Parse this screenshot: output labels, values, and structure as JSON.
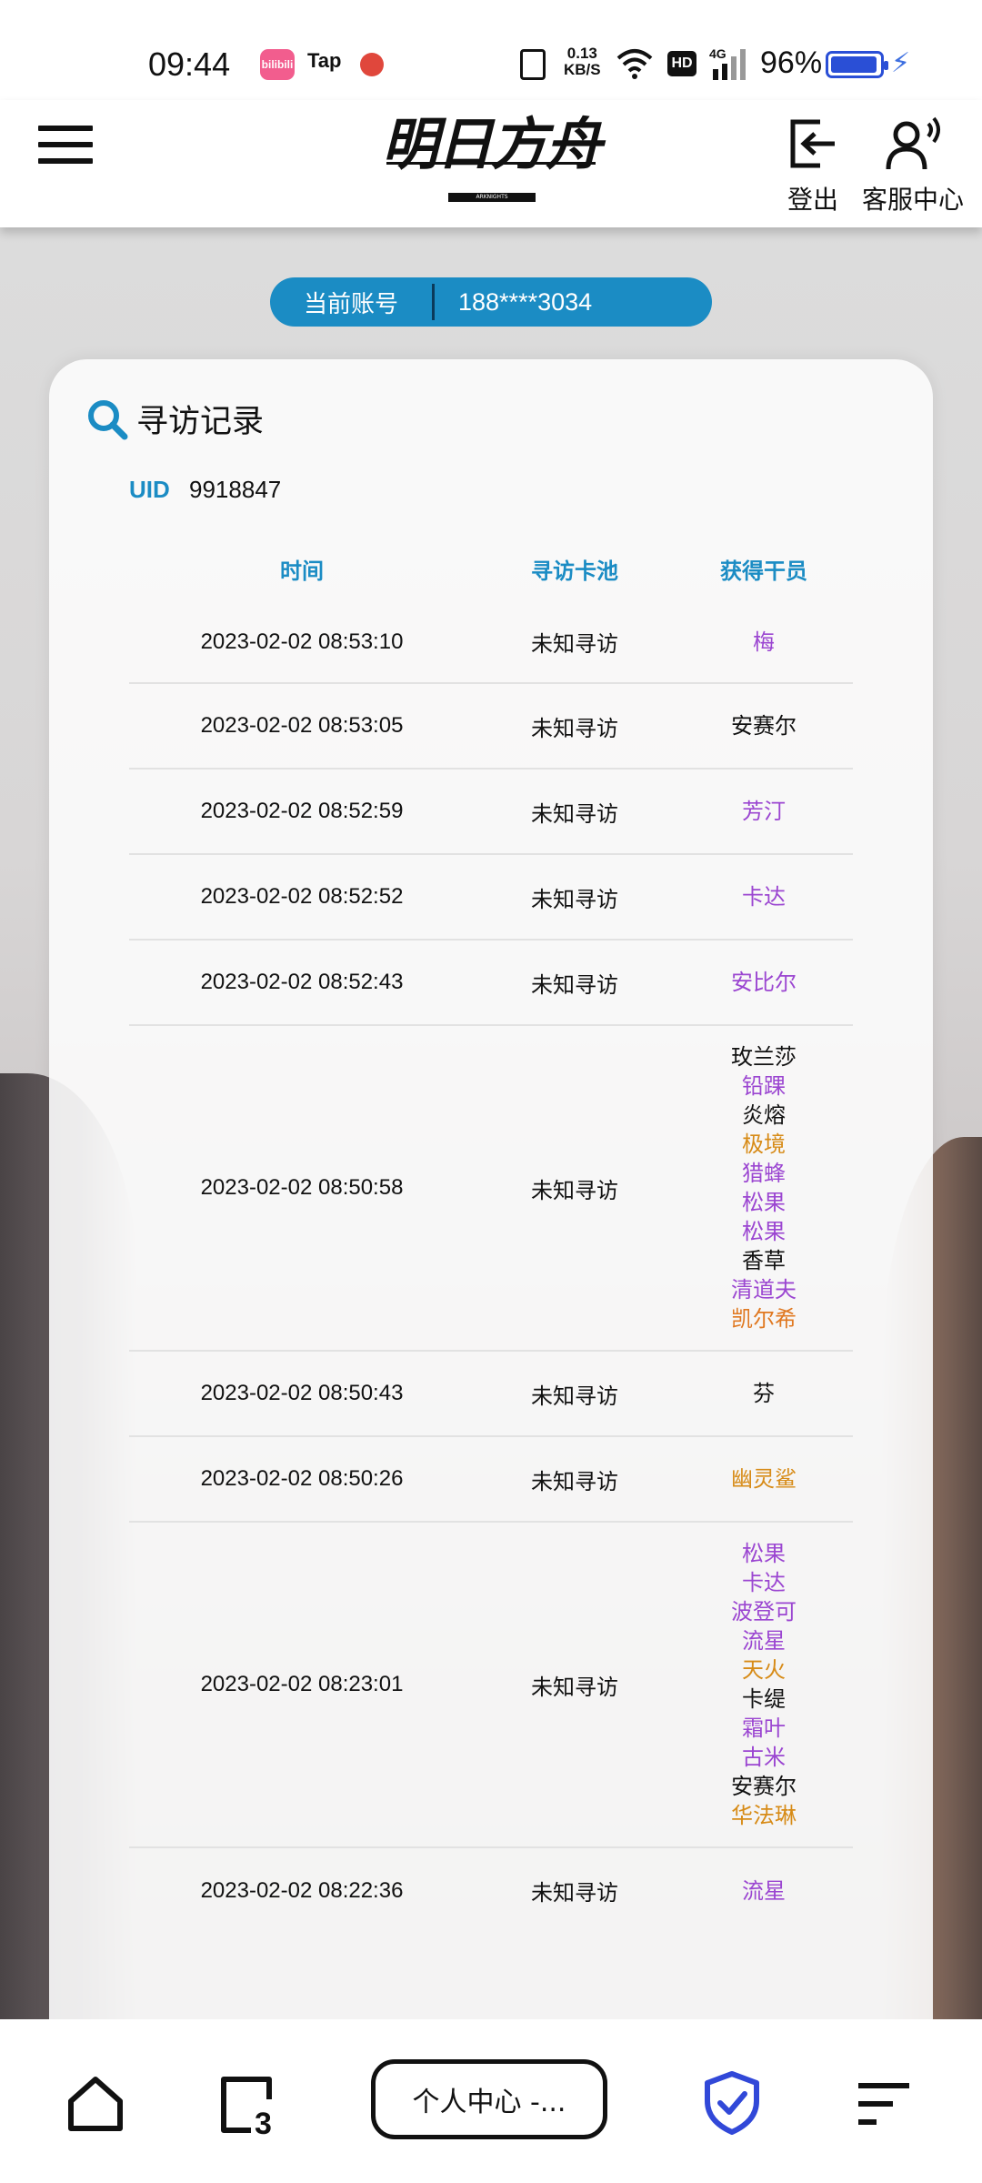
{
  "status_bar": {
    "time": "09:44",
    "apps": [
      "bilibili",
      "Tap"
    ],
    "net_speed_value": "0.13",
    "net_speed_unit": "KB/S",
    "hd": "HD",
    "network": "4G",
    "battery": "96%",
    "battery_level": 0.96
  },
  "header": {
    "logo_text": "明日方舟",
    "logo_sub": "ARKNIGHTS",
    "logout_label": "登出",
    "service_label": "客服中心"
  },
  "account": {
    "label": "当前账号",
    "value": "188****3034"
  },
  "card": {
    "title": "寻访记录",
    "uid_label": "UID",
    "uid_value": "9918847",
    "columns": {
      "time": "时间",
      "pool": "寻访卡池",
      "operator": "获得干员"
    }
  },
  "records": [
    {
      "time": "2023-02-02 08:53:10",
      "pool": "未知寻访",
      "ops": [
        {
          "n": "梅",
          "r": 4
        }
      ]
    },
    {
      "time": "2023-02-02 08:53:05",
      "pool": "未知寻访",
      "ops": [
        {
          "n": "安赛尔",
          "r": 3
        }
      ]
    },
    {
      "time": "2023-02-02 08:52:59",
      "pool": "未知寻访",
      "ops": [
        {
          "n": "芳汀",
          "r": 4
        }
      ]
    },
    {
      "time": "2023-02-02 08:52:52",
      "pool": "未知寻访",
      "ops": [
        {
          "n": "卡达",
          "r": 4
        }
      ]
    },
    {
      "time": "2023-02-02 08:52:43",
      "pool": "未知寻访",
      "ops": [
        {
          "n": "安比尔",
          "r": 4
        }
      ]
    },
    {
      "time": "2023-02-02 08:50:58",
      "pool": "未知寻访",
      "ops": [
        {
          "n": "玫兰莎",
          "r": 3
        },
        {
          "n": "铅踝",
          "r": 4
        },
        {
          "n": "炎熔",
          "r": 3
        },
        {
          "n": "极境",
          "r": 5
        },
        {
          "n": "猎蜂",
          "r": 4
        },
        {
          "n": "松果",
          "r": 4
        },
        {
          "n": "松果",
          "r": 4
        },
        {
          "n": "香草",
          "r": 3
        },
        {
          "n": "清道夫",
          "r": 4
        },
        {
          "n": "凯尔希",
          "r": 6
        }
      ]
    },
    {
      "time": "2023-02-02 08:50:43",
      "pool": "未知寻访",
      "ops": [
        {
          "n": "芬",
          "r": 3
        }
      ]
    },
    {
      "time": "2023-02-02 08:50:26",
      "pool": "未知寻访",
      "ops": [
        {
          "n": "幽灵鲨",
          "r": 5
        }
      ]
    },
    {
      "time": "2023-02-02 08:23:01",
      "pool": "未知寻访",
      "ops": [
        {
          "n": "松果",
          "r": 4
        },
        {
          "n": "卡达",
          "r": 4
        },
        {
          "n": "波登可",
          "r": 4
        },
        {
          "n": "流星",
          "r": 4
        },
        {
          "n": "天火",
          "r": 5
        },
        {
          "n": "卡缇",
          "r": 3
        },
        {
          "n": "霜叶",
          "r": 4
        },
        {
          "n": "古米",
          "r": 4
        },
        {
          "n": "安赛尔",
          "r": 3
        },
        {
          "n": "华法琳",
          "r": 5
        }
      ]
    },
    {
      "time": "2023-02-02 08:22:36",
      "pool": "未知寻访",
      "ops": [
        {
          "n": "流星",
          "r": 4
        }
      ]
    }
  ],
  "rarity_colors": {
    "3": "#111111",
    "4": "#9b46d1",
    "5": "#d78b17",
    "6": "#e07820"
  },
  "bottom_nav": {
    "center_label": "个人中心 -...",
    "tab_count": "3"
  }
}
